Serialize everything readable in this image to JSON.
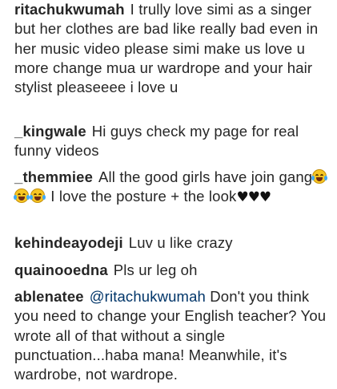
{
  "comments": [
    {
      "username": "ritachukwumah",
      "text": "I trully love simi as a singer but her clothes are bad like really bad even in her music video please simi make us love u more change mua ur wardrope and your hair stylist pleaseeee i love u"
    },
    {
      "username": "_kingwale",
      "text": "Hi guys check my page for real funny videos"
    },
    {
      "username": "_themmiee",
      "text_before": "All the good girls have join gang",
      "emoji": "face-with-tears-of-joy",
      "emoji_count": 3,
      "text_after": " I love the posture + the look",
      "hearts": "♥♥♥"
    },
    {
      "username": "kehindeayodeji",
      "text": "Luv u like crazy"
    },
    {
      "username": "quainooedna",
      "text": "Pls ur leg oh"
    },
    {
      "username": "ablenatee",
      "mention": "@ritachukwumah",
      "text": " Don't you think you need to change your English teacher? You wrote all of that without a single punctuation...haba mana! Meanwhile, it's wardrobe, not wardrope."
    }
  ],
  "colors": {
    "text": "#262626",
    "mention": "#003569",
    "background": "#ffffff"
  }
}
